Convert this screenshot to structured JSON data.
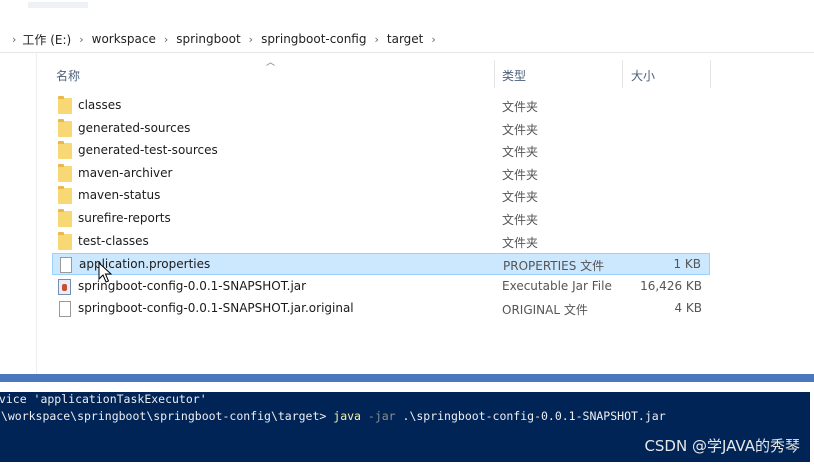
{
  "address": {
    "crumbs": [
      "工作 (E:)",
      "workspace",
      "springboot",
      "springboot-config",
      "target"
    ]
  },
  "columns": {
    "name": "名称",
    "type": "类型",
    "size": "大小"
  },
  "files": [
    {
      "name": "classes",
      "type": "文件夹",
      "size": "",
      "icon": "folder-icon"
    },
    {
      "name": "generated-sources",
      "type": "文件夹",
      "size": "",
      "icon": "folder-icon"
    },
    {
      "name": "generated-test-sources",
      "type": "文件夹",
      "size": "",
      "icon": "folder-icon"
    },
    {
      "name": "maven-archiver",
      "type": "文件夹",
      "size": "",
      "icon": "folder-icon"
    },
    {
      "name": "maven-status",
      "type": "文件夹",
      "size": "",
      "icon": "folder-icon"
    },
    {
      "name": "surefire-reports",
      "type": "文件夹",
      "size": "",
      "icon": "folder-icon"
    },
    {
      "name": "test-classes",
      "type": "文件夹",
      "size": "",
      "icon": "folder-icon"
    },
    {
      "name": "application.properties",
      "type": "PROPERTIES 文件",
      "size": "1 KB",
      "icon": "file-icon",
      "selected": true
    },
    {
      "name": "springboot-config-0.0.1-SNAPSHOT.jar",
      "type": "Executable Jar File",
      "size": "16,426 KB",
      "icon": "jar-icon"
    },
    {
      "name": "springboot-config-0.0.1-SNAPSHOT.jar.original",
      "type": "ORIGINAL 文件",
      "size": "4 KB",
      "icon": "file-icon"
    }
  ],
  "terminal": {
    "line1": "rvice 'applicationTaskExecutor'",
    "line2_prompt": ":\\workspace\\springboot\\springboot-config\\target> ",
    "line2_cmd": "java",
    "line2_flag": " -jar",
    "line2_rest": " .\\springboot-config-0.0.1-SNAPSHOT.jar"
  },
  "watermark": "CSDN @学JAVA的秀琴",
  "colors": {
    "selection": "#cce8ff",
    "folder": "#f8d775",
    "terminal_bg": "#012456",
    "divider_bar": "#4a78bf"
  }
}
